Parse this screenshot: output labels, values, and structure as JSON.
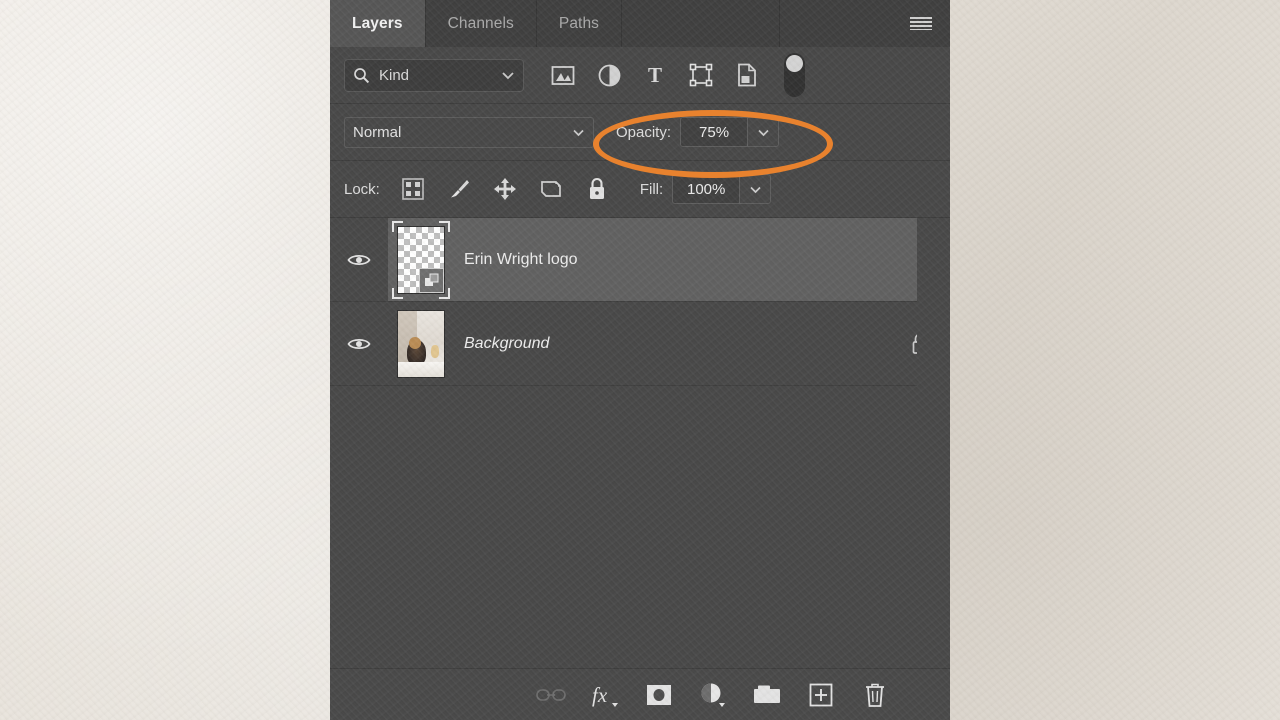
{
  "panel": {
    "tabs": [
      {
        "label": "Layers",
        "active": true
      },
      {
        "label": "Channels",
        "active": false
      },
      {
        "label": "Paths",
        "active": false
      }
    ],
    "menu_icon": "hamburger-menu-icon"
  },
  "filter": {
    "kind_label": "Kind",
    "search_icon": "search-icon",
    "chevron_icon": "chevron-down-icon",
    "type_icons": [
      "pixel-layer-filter-icon",
      "adjustment-layer-filter-icon",
      "type-layer-filter-icon",
      "shape-layer-filter-icon",
      "smart-object-filter-icon"
    ],
    "toggle_icon": "filter-toggle-switch"
  },
  "blend": {
    "mode": "Normal",
    "opacity_label": "Opacity:",
    "opacity_value": "75%"
  },
  "lock": {
    "label": "Lock:",
    "icons": [
      "lock-transparent-pixels-icon",
      "lock-image-pixels-icon",
      "lock-position-icon",
      "lock-artboard-nesting-icon",
      "lock-all-icon"
    ],
    "fill_label": "Fill:",
    "fill_value": "100%"
  },
  "layers": [
    {
      "name": "Erin Wright logo",
      "selected": true,
      "italic": false,
      "locked": false,
      "visible": true,
      "thumb_type": "transparent-smart-object"
    },
    {
      "name": "Background",
      "selected": false,
      "italic": true,
      "locked": true,
      "visible": true,
      "thumb_type": "photo"
    }
  ],
  "bottom_toolbar": [
    {
      "name": "link-layers-button",
      "icon": "link-icon",
      "disabled": true
    },
    {
      "name": "layer-style-button",
      "icon": "fx-icon",
      "disabled": false
    },
    {
      "name": "add-layer-mask-button",
      "icon": "layer-mask-icon",
      "disabled": false
    },
    {
      "name": "adjustment-layer-button",
      "icon": "adjustment-layer-icon",
      "disabled": false
    },
    {
      "name": "new-group-button",
      "icon": "folder-icon",
      "disabled": false
    },
    {
      "name": "new-layer-button",
      "icon": "new-layer-plus-icon",
      "disabled": false
    },
    {
      "name": "delete-layer-button",
      "icon": "trash-icon",
      "disabled": false
    }
  ],
  "annotation": {
    "highlight_color": "#e8822e",
    "highlight_target": "opacity-control",
    "shape": "ellipse"
  },
  "colors": {
    "panel_background": "#454545",
    "tab_inactive": "#3c3c3c",
    "tab_active": "#535353",
    "selected_layer": "#5e5e5e",
    "text": "#ececec",
    "backdrop": "#e6e1d9"
  }
}
